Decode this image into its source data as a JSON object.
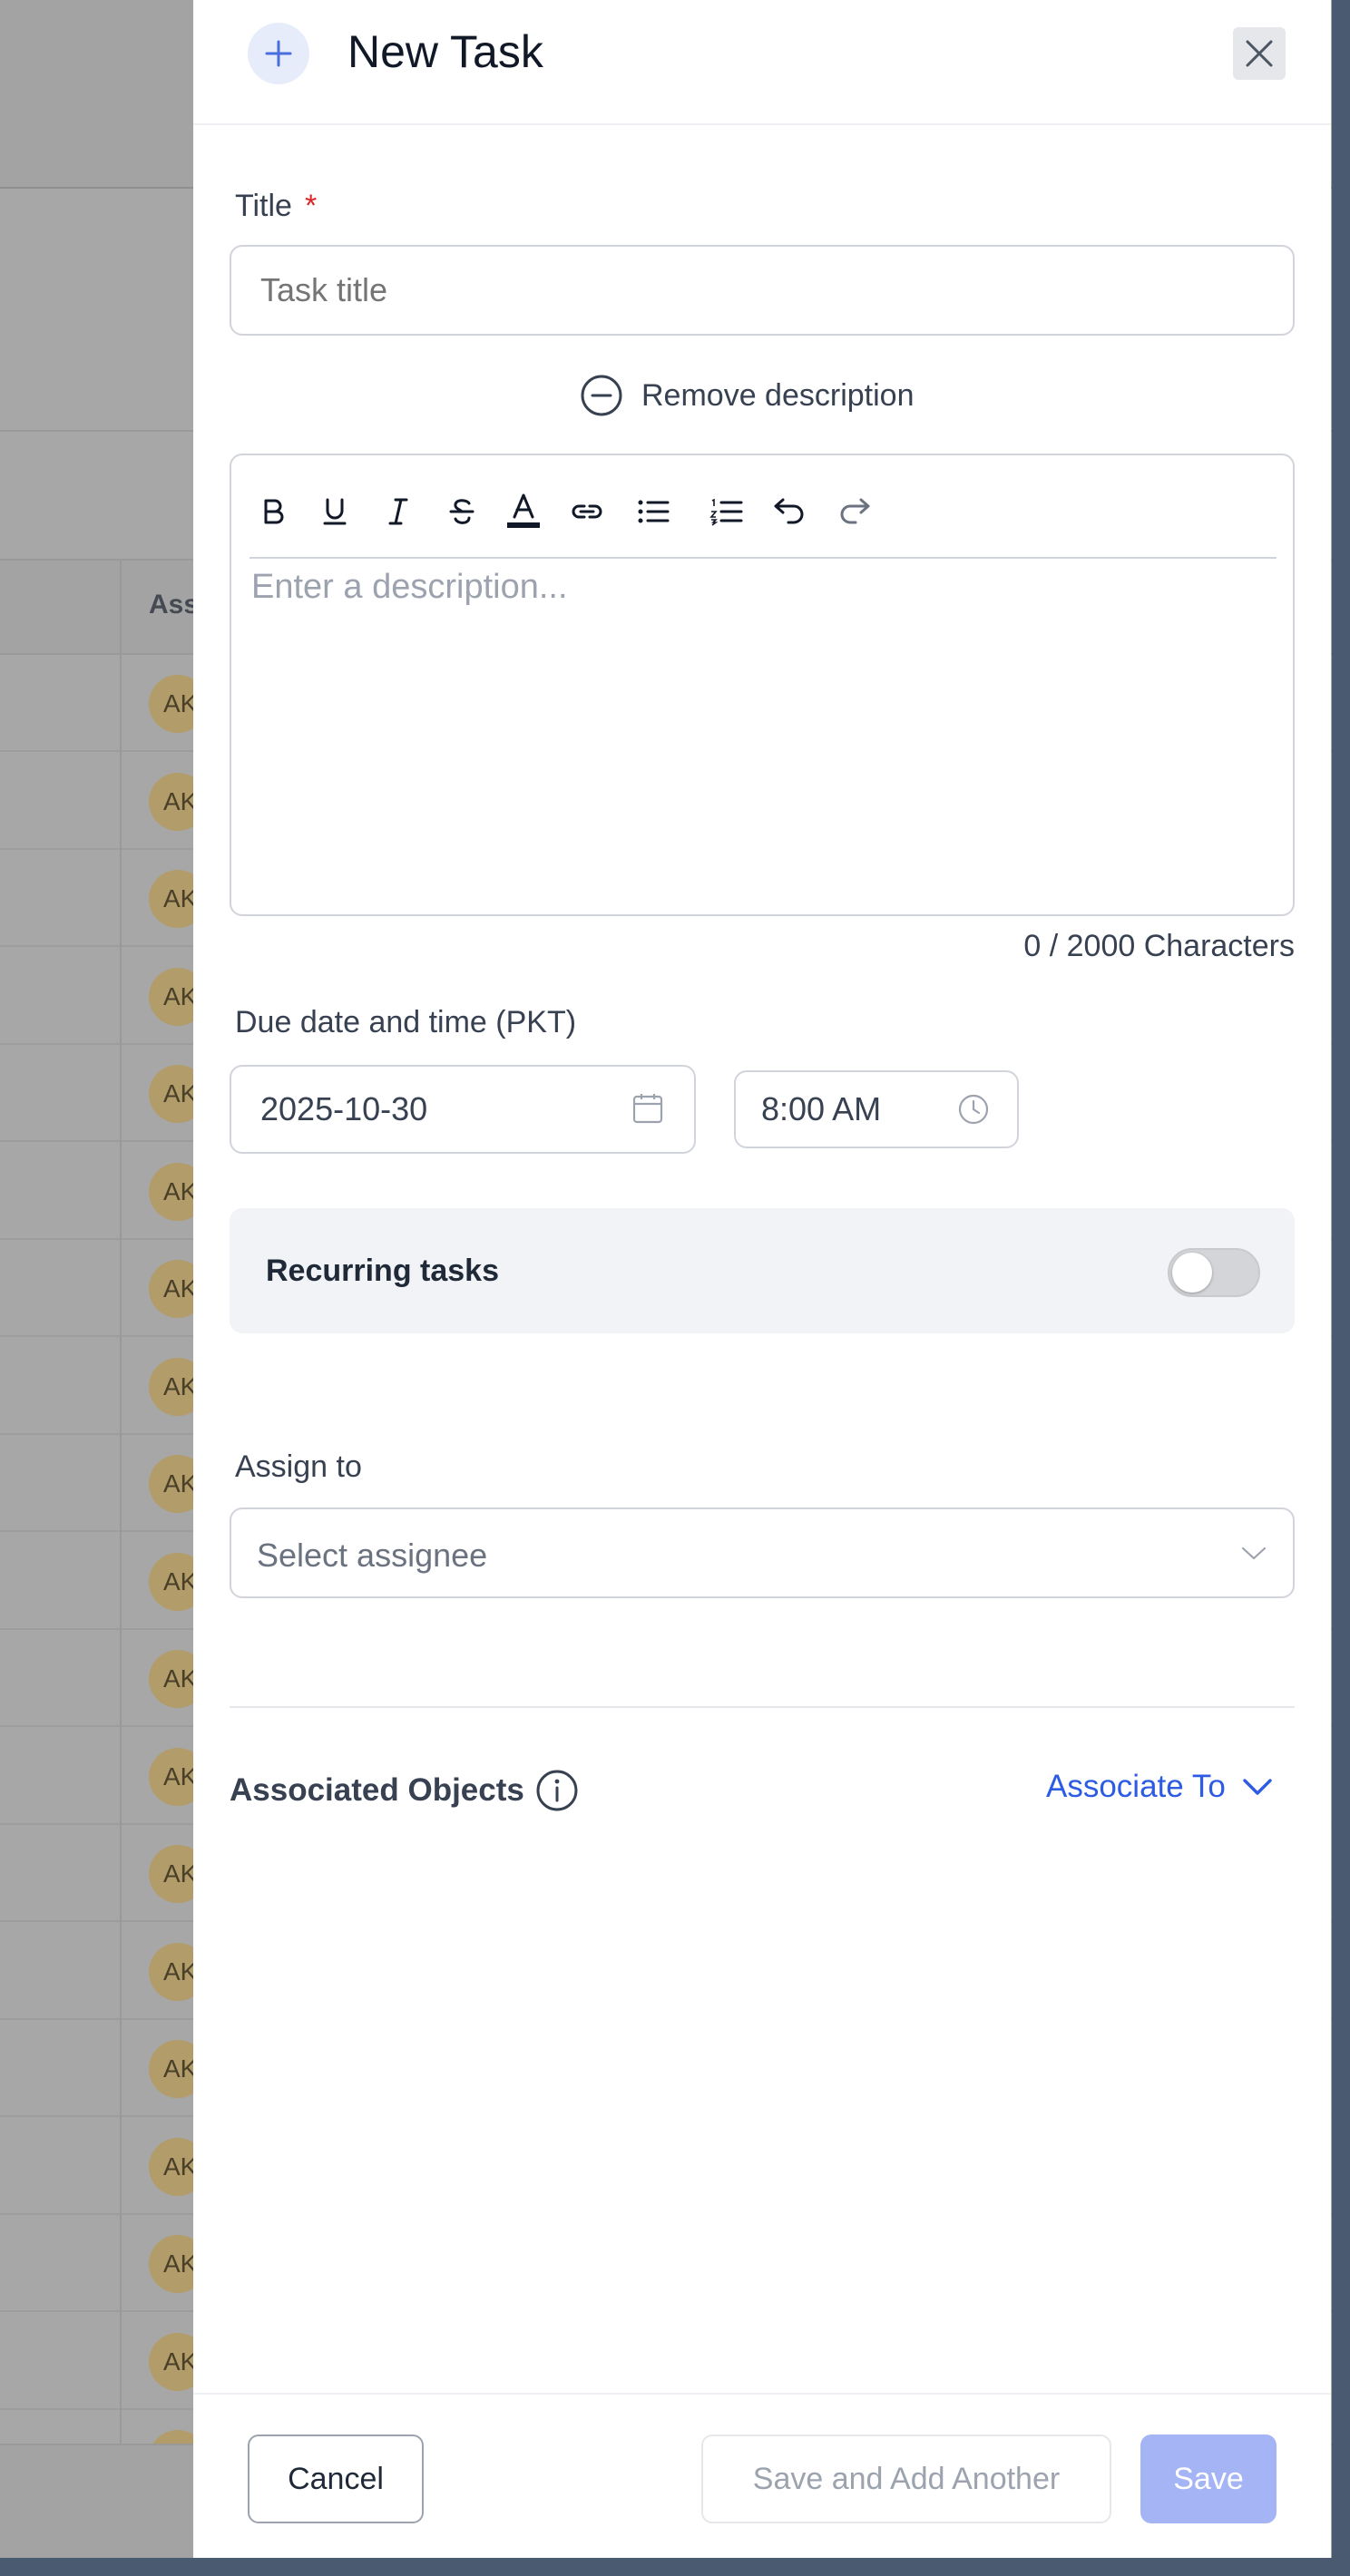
{
  "background": {
    "column_header": "Ass",
    "avatar_initials": "AK",
    "row_count": 19
  },
  "panel": {
    "title": "New Task"
  },
  "form": {
    "title_label": "Title",
    "required_marker": "*",
    "title_placeholder": "Task title",
    "remove_description": "Remove description",
    "description_placeholder": "Enter a description...",
    "char_count": "0 / 2000 Characters",
    "due_label": "Due date and time (PKT)",
    "due_date": "2025-10-30",
    "due_time": "8:00 AM",
    "recurring_label": "Recurring tasks",
    "recurring_enabled": false,
    "assign_label": "Assign to",
    "assignee_placeholder": "Select assignee",
    "associated_label": "Associated Objects",
    "associate_to": "Associate To"
  },
  "toolbar": {
    "buttons": [
      "bold-icon",
      "underline-icon",
      "italic-icon",
      "strikethrough-icon",
      "text-color-icon",
      "link-icon",
      "bullet-list-icon",
      "numbered-list-icon",
      "undo-icon",
      "redo-icon"
    ]
  },
  "footer": {
    "cancel": "Cancel",
    "save_add": "Save and Add Another",
    "save": "Save"
  },
  "colors": {
    "primary": "#2d5be3",
    "save_disabled": "#a5b4f5",
    "required": "#dc2626"
  }
}
